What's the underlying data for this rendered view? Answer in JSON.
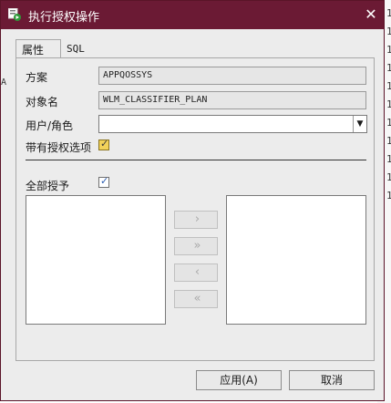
{
  "window": {
    "title": "执行授权操作",
    "close_glyph": "✕"
  },
  "tabs": [
    {
      "label": "属性"
    },
    {
      "label": "SQL"
    }
  ],
  "form": {
    "scheme_label": "方案",
    "scheme_value": "APPQOSSYS",
    "object_label": "对象名",
    "object_value": "WLM_CLASSIFIER_PLAN",
    "user_role_label": "用户/角色",
    "user_role_value": "",
    "with_grant_label": "带有授权选项",
    "with_grant_checked": true,
    "grant_all_label": "全部授予",
    "grant_all_checked": true
  },
  "transfer": {
    "move_right": "›",
    "move_all_right": "»",
    "move_left": "‹",
    "move_all_left": "«"
  },
  "buttons": {
    "apply": "应用(A)",
    "cancel": "取消"
  },
  "background_text": {
    "right_chars": [
      "1",
      "1",
      "1",
      "1",
      "1",
      "1",
      "1",
      "1",
      "1",
      "1",
      "1"
    ],
    "left_char": "A"
  },
  "colors": {
    "titlebar": "#6b1a34",
    "checkbox_yellow": "#f2d25a"
  }
}
